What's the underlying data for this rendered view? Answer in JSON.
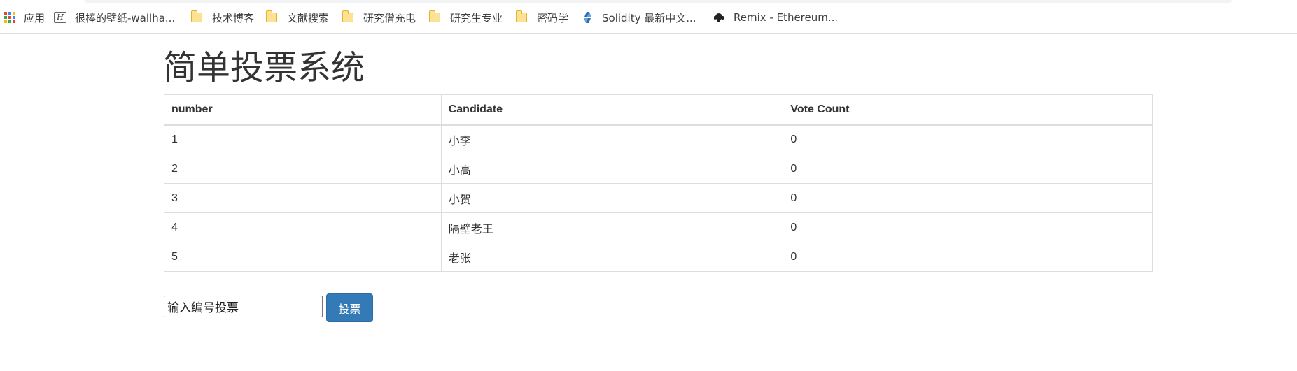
{
  "bookmarks": {
    "apps_label": "应用",
    "items": [
      {
        "label": "很棒的壁纸-wallha...",
        "icon": "wallhaven-icon"
      },
      {
        "label": "技术博客",
        "icon": "folder-icon"
      },
      {
        "label": "文献搜索",
        "icon": "folder-icon"
      },
      {
        "label": "研究僧充电",
        "icon": "folder-icon"
      },
      {
        "label": "研究生专业",
        "icon": "folder-icon"
      },
      {
        "label": "密码学",
        "icon": "folder-icon"
      },
      {
        "label": "Solidity 最新中文...",
        "icon": "solidity-icon"
      },
      {
        "label": "Remix - Ethereum...",
        "icon": "remix-icon"
      }
    ]
  },
  "page": {
    "title": "简单投票系统"
  },
  "table": {
    "headers": [
      "number",
      "Candidate",
      "Vote Count"
    ],
    "rows": [
      {
        "number": "1",
        "candidate": "小李",
        "votes": "0"
      },
      {
        "number": "2",
        "candidate": "小高",
        "votes": "0"
      },
      {
        "number": "3",
        "candidate": "小贺",
        "votes": "0"
      },
      {
        "number": "4",
        "candidate": "隔壁老王",
        "votes": "0"
      },
      {
        "number": "5",
        "candidate": "老张",
        "votes": "0"
      }
    ]
  },
  "vote": {
    "input_value": "输入编号投票",
    "button_label": "投票"
  },
  "colors": {
    "primary_button": "#337ab7",
    "text": "#333333",
    "table_border": "#dddddd"
  }
}
